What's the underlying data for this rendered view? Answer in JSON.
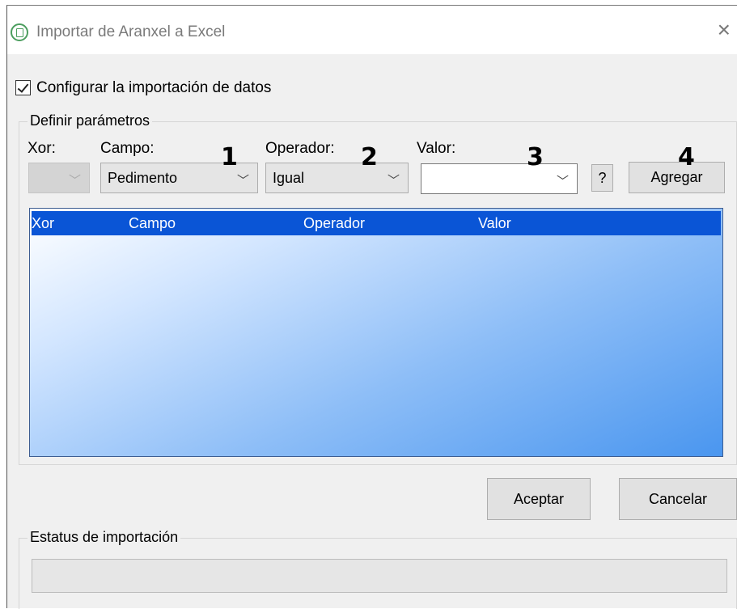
{
  "window": {
    "title": "Importar de Aranxel a Excel",
    "close_glyph": "×",
    "app_icon": "spreadsheet-circle-icon"
  },
  "config_checkbox": {
    "label": "Configurar la importación de datos",
    "checked": true
  },
  "params": {
    "group_title": "Definir parámetros",
    "xor_label": "Xor:",
    "campo_label": "Campo:",
    "operador_label": "Operador:",
    "valor_label": "Valor:",
    "xor_value": "",
    "campo_value": "Pedimento",
    "operador_value": "Igual",
    "valor_value": "",
    "chevron": "﹀",
    "help_label": "?",
    "add_label": "Agregar"
  },
  "annotations": [
    "1",
    "2",
    "3",
    "4"
  ],
  "table": {
    "columns": [
      "Xor",
      "Campo",
      "Operador",
      "Valor"
    ],
    "rows": []
  },
  "actions": {
    "accept_label": "Aceptar",
    "cancel_label": "Cancelar"
  },
  "status": {
    "group_title": "Estatus de importación",
    "progress": 0
  },
  "colors": {
    "list_header": "#0a55d6",
    "list_gradient_end": "#4a96ef",
    "icon_green": "#4c9e5f"
  }
}
